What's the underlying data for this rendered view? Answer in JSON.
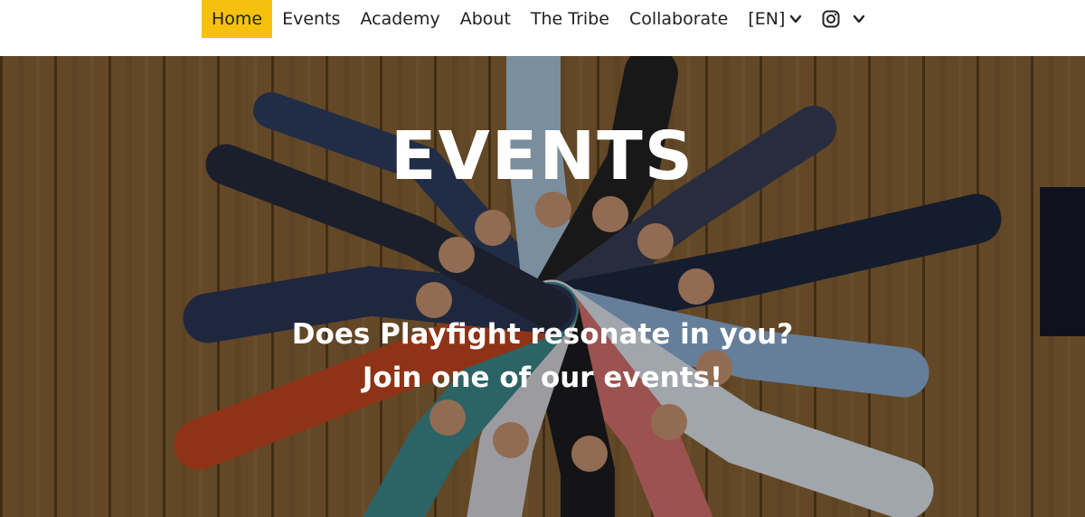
{
  "nav": {
    "items": [
      {
        "label": "Home",
        "active": true
      },
      {
        "label": "Events"
      },
      {
        "label": "Academy"
      },
      {
        "label": "About"
      },
      {
        "label": "The Tribe"
      },
      {
        "label": "Collaborate"
      }
    ],
    "language": "[EN]",
    "language_icon": "chevron-down-icon",
    "social_icon": "instagram-icon",
    "social_menu_icon": "chevron-down-icon",
    "active_color": "#f6c10e"
  },
  "hero": {
    "title": "EVENTS",
    "subtitle_line1": "Does Playfight resonate in you?",
    "subtitle_line2": "Join one of our events!",
    "image": "group-lying-in-circle-photo"
  }
}
